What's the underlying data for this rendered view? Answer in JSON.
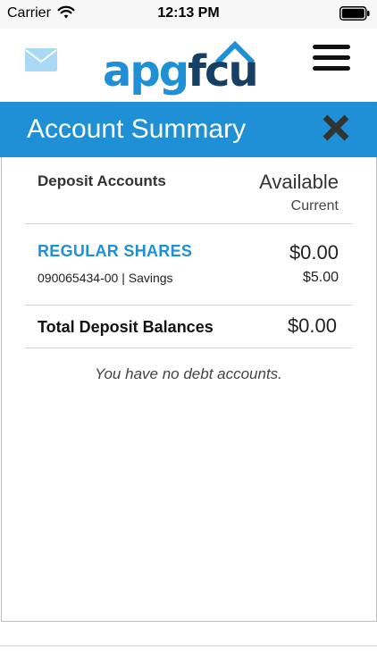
{
  "status_bar": {
    "carrier": "Carrier",
    "time": "12:13 PM"
  },
  "header": {
    "logo_text": "apgfcu",
    "logo_colors": {
      "apg": "#1f8fd6",
      "fcu": "#163f66"
    },
    "icons": {
      "mail": "mail-icon",
      "menu": "menu-icon"
    }
  },
  "title_bar": {
    "title": "Account Summary",
    "close_icon": "close-icon",
    "color": "#1f8fd6"
  },
  "deposit": {
    "section_label": "Deposit Accounts",
    "available_label": "Available",
    "current_label": "Current",
    "accounts": [
      {
        "name": "REGULAR SHARES",
        "meta": "090065434-00 | Savings",
        "available": "$0.00",
        "current": "$5.00"
      }
    ],
    "total_label": "Total Deposit Balances",
    "total_value": "$0.00"
  },
  "debt": {
    "message": "You have no debt accounts."
  }
}
